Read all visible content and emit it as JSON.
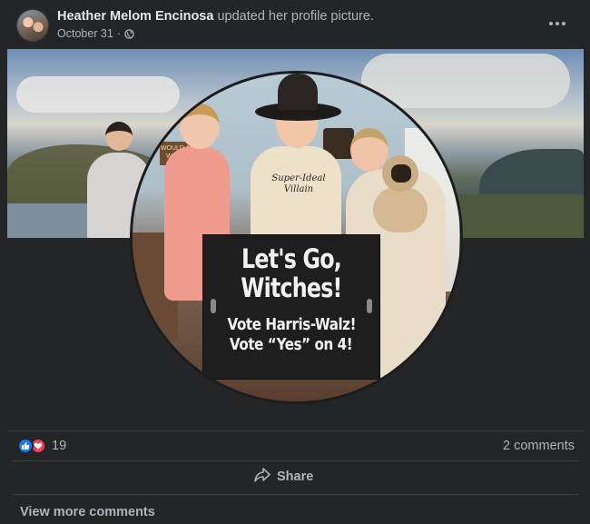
{
  "post": {
    "author": "Heather Melom Encinosa",
    "action": "updated her profile picture.",
    "date": "October 31",
    "date_separator": "·",
    "privacy_icon": "globe-icon",
    "more_icon": "more-horizontal-icon"
  },
  "photo": {
    "sign": {
      "line1": "Let's Go,",
      "line2": "Witches!",
      "line3": "Vote Harris-Walz!",
      "line4": "Vote “Yes” on 4!"
    },
    "shirt_text": "Super-Ideal Villain",
    "small_sign": "WOULD A BAD WIT WEAR"
  },
  "engagement": {
    "reaction_icons": [
      "like-icon",
      "love-icon"
    ],
    "reaction_count": "19",
    "comments": "2 comments"
  },
  "actions": {
    "share_label": "Share",
    "share_icon": "share-arrow-icon"
  },
  "footer": {
    "view_more": "View more comments"
  },
  "colors": {
    "background": "#242526",
    "primary_text": "#e4e6eb",
    "secondary_text": "#b0b3b8",
    "like_blue": "#1877f2",
    "love_red": "#f33e58",
    "divider": "#3e4042"
  }
}
